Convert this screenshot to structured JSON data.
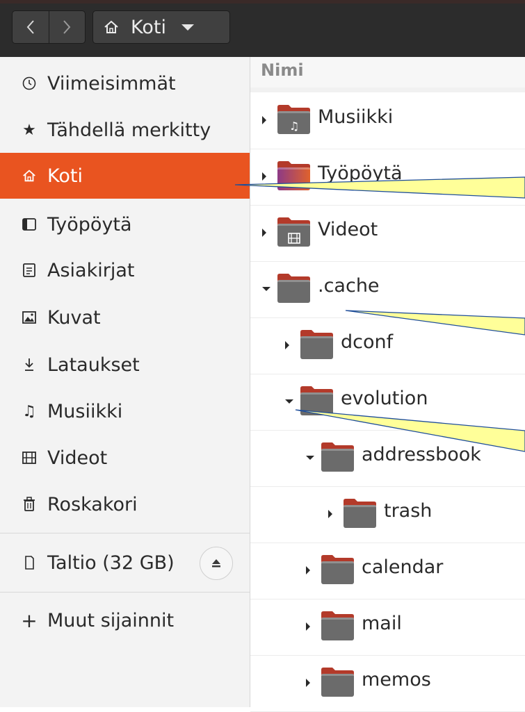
{
  "header": {
    "back_label": "back",
    "forward_label": "forward",
    "path_label": "Koti"
  },
  "sidebar": {
    "items": [
      {
        "label": "Viimeisimmät",
        "icon": "recent-clock-icon"
      },
      {
        "label": "Tähdellä merkitty",
        "icon": "star-icon"
      },
      {
        "label": "Koti",
        "icon": "home-icon",
        "active": true
      },
      {
        "label": "Työpöytä",
        "icon": "desktop-icon"
      },
      {
        "label": "Asiakirjat",
        "icon": "documents-icon"
      },
      {
        "label": "Kuvat",
        "icon": "pictures-icon"
      },
      {
        "label": "Lataukset",
        "icon": "downloads-icon"
      },
      {
        "label": "Musiikki",
        "icon": "music-icon"
      },
      {
        "label": "Videot",
        "icon": "videos-icon"
      },
      {
        "label": "Roskakori",
        "icon": "trash-icon"
      }
    ],
    "devices": [
      {
        "label": "Taltio (32 GB)",
        "icon": "drive-icon",
        "eject_icon": "eject-icon"
      }
    ],
    "other_locations": {
      "label": "Muut sijainnit",
      "icon": "plus-icon"
    }
  },
  "main": {
    "column_header": "Nimi",
    "rows": [
      {
        "name": "Musiikki",
        "expander": "closed",
        "depth": 0,
        "emblem": "music-note"
      },
      {
        "name": "Työpöytä",
        "expander": "closed",
        "depth": 0,
        "emblem": "desktop"
      },
      {
        "name": "Videot",
        "expander": "closed",
        "depth": 0,
        "emblem": "film"
      },
      {
        "name": ".cache",
        "expander": "open",
        "depth": 0,
        "emblem": "none"
      },
      {
        "name": "dconf",
        "expander": "closed",
        "depth": 1,
        "emblem": "none"
      },
      {
        "name": "evolution",
        "expander": "open",
        "depth": 1,
        "emblem": "none"
      },
      {
        "name": "addressbook",
        "expander": "open",
        "depth": 2,
        "emblem": "none"
      },
      {
        "name": "trash",
        "expander": "closed",
        "depth": 3,
        "emblem": "none"
      },
      {
        "name": "calendar",
        "expander": "closed",
        "depth": 2,
        "emblem": "none"
      },
      {
        "name": "mail",
        "expander": "closed",
        "depth": 2,
        "emblem": "none"
      },
      {
        "name": "memos",
        "expander": "closed",
        "depth": 2,
        "emblem": "none"
      }
    ]
  },
  "colors": {
    "accent": "#e95420",
    "header_bg": "#2c2c2c",
    "sidebar_bg": "#f3f3f3",
    "callout_fill": "#ffff99",
    "callout_stroke": "#1f4e9a",
    "folder_body": "#6b6b6b",
    "folder_tab": "#b33a2a"
  }
}
